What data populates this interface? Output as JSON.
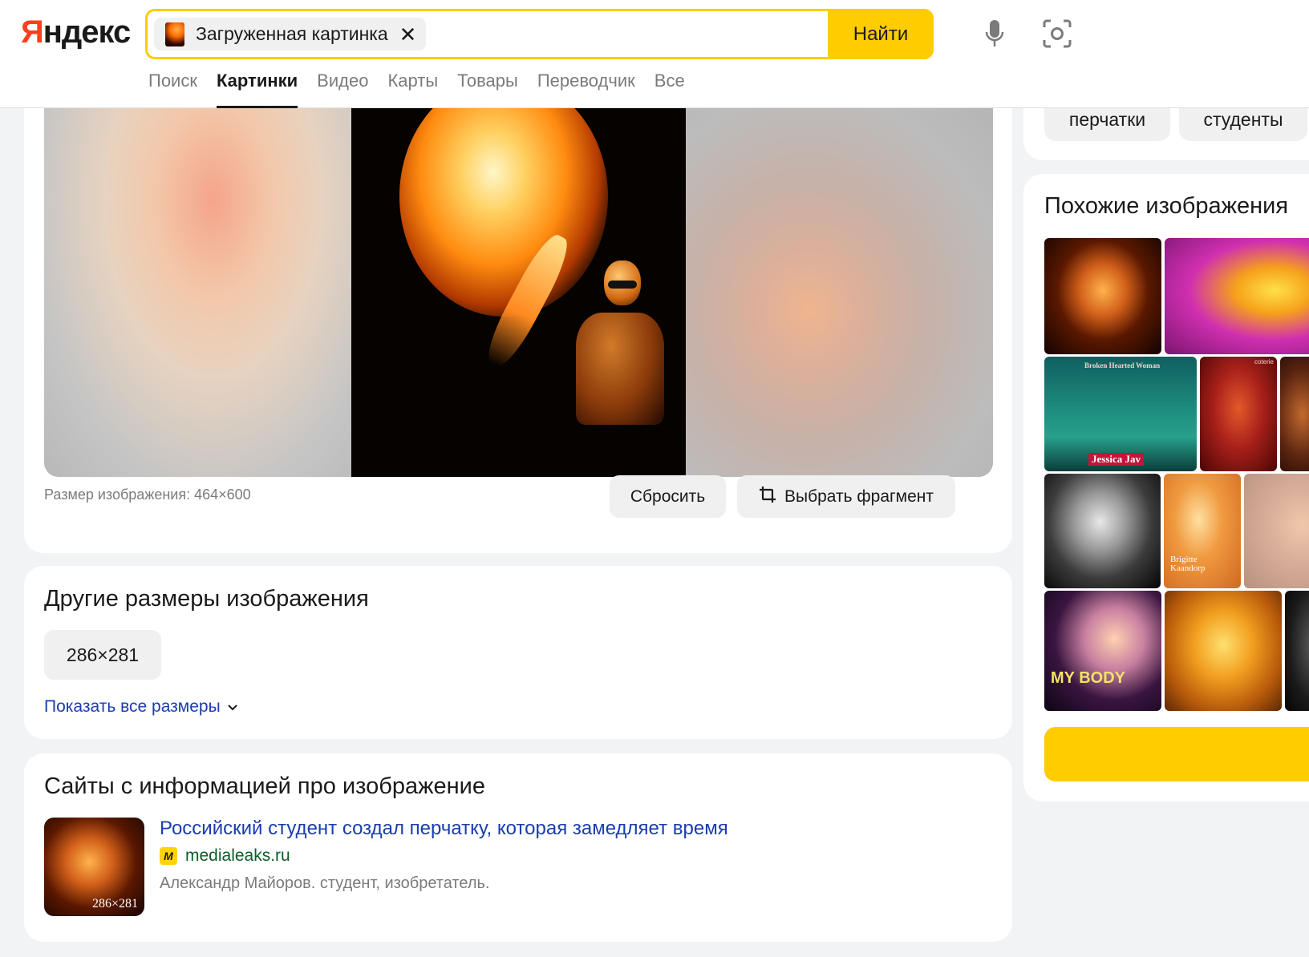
{
  "header": {
    "logo": "Яндекс",
    "search_chip_label": "Загруженная картинка",
    "search_placeholder": "",
    "find_label": "Найти"
  },
  "nav": {
    "tabs": [
      {
        "label": "Поиск",
        "active": false
      },
      {
        "label": "Картинки",
        "active": true
      },
      {
        "label": "Видео",
        "active": false
      },
      {
        "label": "Карты",
        "active": false
      },
      {
        "label": "Товары",
        "active": false
      },
      {
        "label": "Переводчик",
        "active": false
      },
      {
        "label": "Все",
        "active": false
      }
    ]
  },
  "viewer": {
    "size_text": "Размер изображения: 464×600",
    "reset_label": "Сбросить",
    "crop_label": "Выбрать фрагмент"
  },
  "other_sizes": {
    "title": "Другие размеры изображения",
    "sizes": [
      "286×281"
    ],
    "show_all_label": "Показать все размеры"
  },
  "sites": {
    "title": "Сайты с информацией про изображение",
    "items": [
      {
        "title": "Российский студент создал перчатку, которая замедляет время",
        "domain": "medialeaks.ru",
        "favicon_letter": "M",
        "description": "Александр Майоров. студент, изобретатель.",
        "thumb_size": "286×281"
      }
    ]
  },
  "tags": [
    "перчатки",
    "студенты"
  ],
  "similar": {
    "title": "Похожие изображения",
    "captions": [
      "Broken Hearted Woman",
      "Jessica Jav",
      "coterie",
      "Brigitte Kaandorp",
      "MY BODY"
    ]
  },
  "colors": {
    "accent": "#ffcc00",
    "logo_red": "#fc3f1d",
    "link": "#1b3dac",
    "domain_green": "#0b5d28"
  }
}
